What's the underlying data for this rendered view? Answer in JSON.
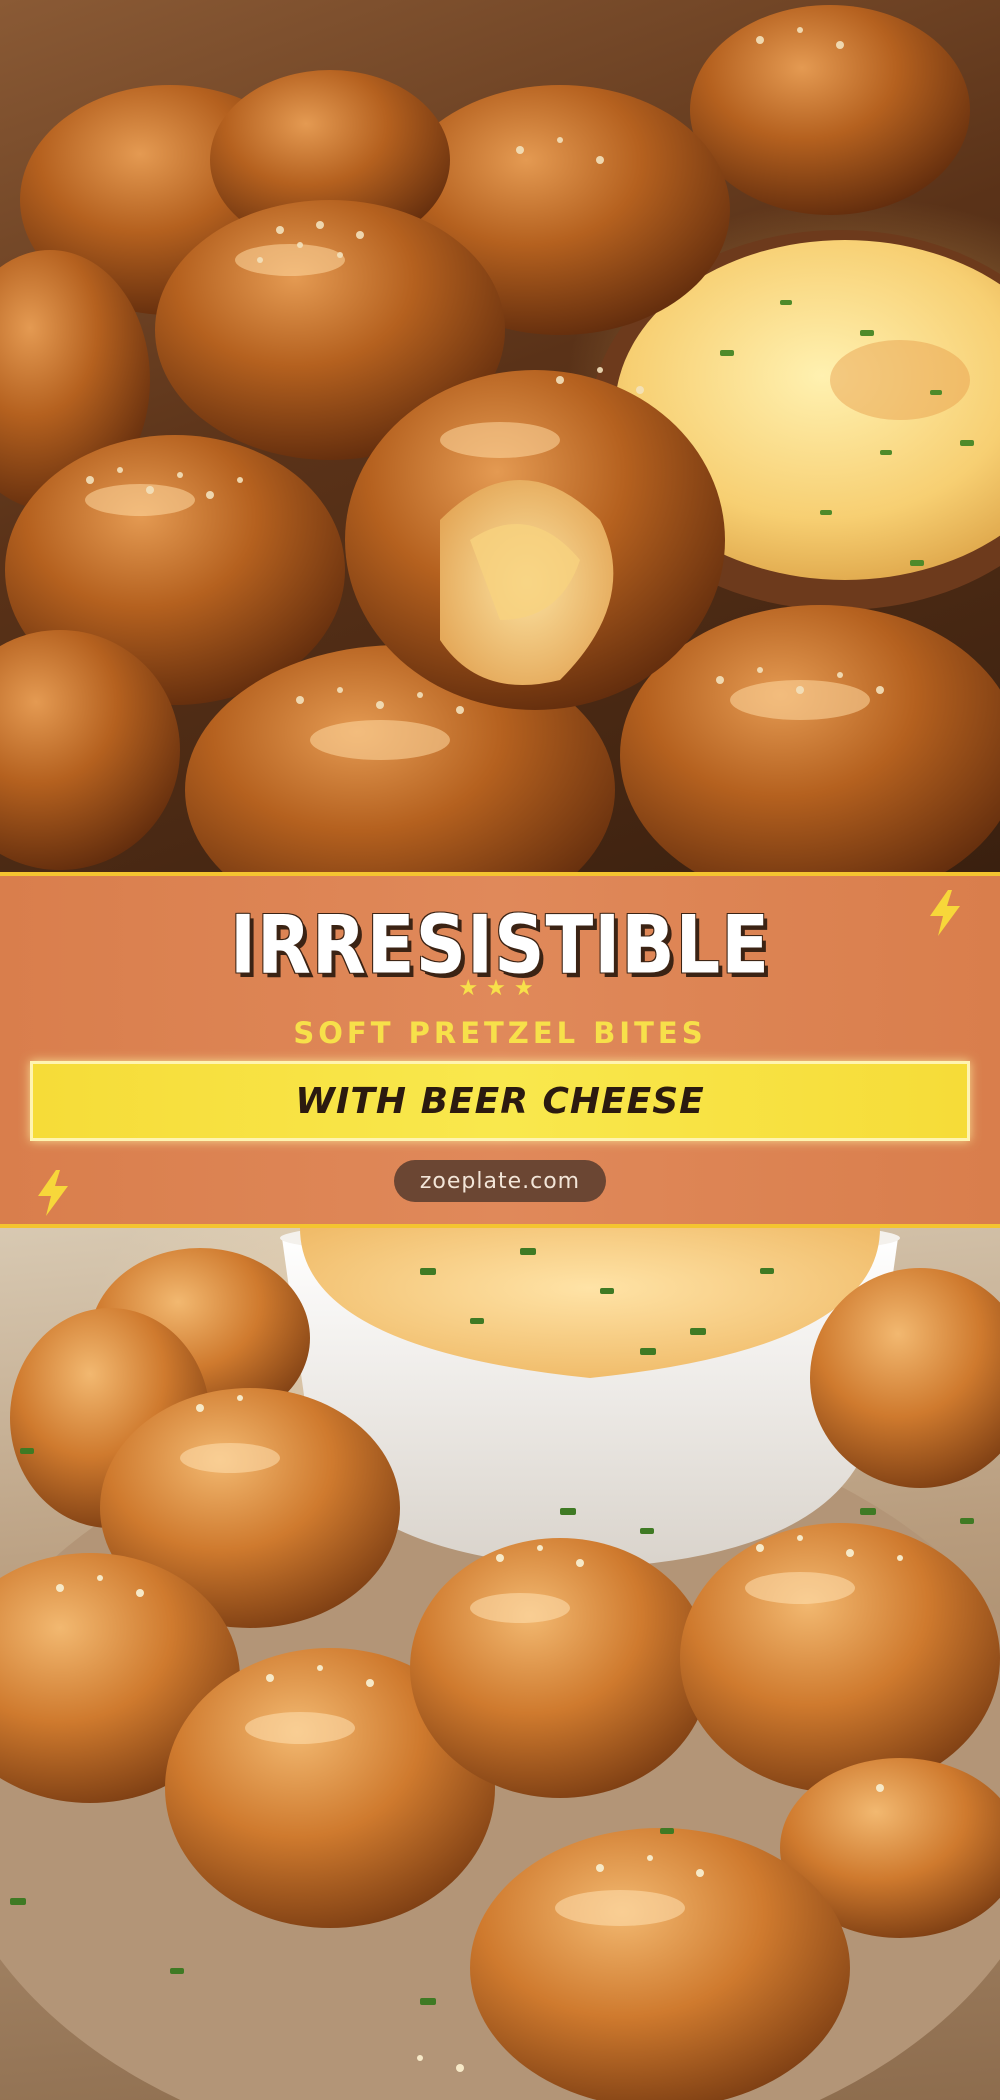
{
  "banner": {
    "headline": "IRRESISTIBLE",
    "stars": "★★★",
    "subtitle": "SOFT PRETZEL BITES",
    "strip_text": "WITH BEER CHEESE",
    "url": "zoeplate.com"
  },
  "colors": {
    "banner_orange": "#e0895a",
    "accent_yellow": "#f6dc38",
    "border_gold": "#f4c430",
    "pill_brown": "#6b4633"
  },
  "icons": {
    "decor": "lightning-bolt-icon"
  }
}
